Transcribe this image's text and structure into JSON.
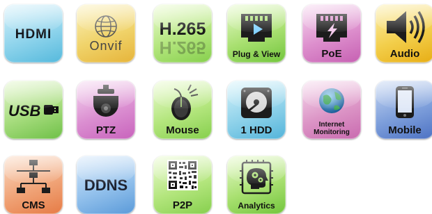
{
  "tiles": {
    "hdmi": {
      "text": "HDMI",
      "icon": "hdmi-logo-icon"
    },
    "onvif": {
      "text": "Onvif",
      "icon": "globe-icon"
    },
    "h265": {
      "text": "H.265",
      "reflection": "H.265",
      "icon": "h265-logo-icon"
    },
    "plug": {
      "label": "Plug & View",
      "icon": "ethernet-play-icon"
    },
    "poe": {
      "label": "PoE",
      "icon": "ethernet-power-icon"
    },
    "audio": {
      "label": "Audio",
      "icon": "speaker-icon"
    },
    "usb": {
      "text": "USB",
      "icon": "usb-icon"
    },
    "ptz": {
      "label": "PTZ",
      "icon": "dome-camera-icon"
    },
    "mouse": {
      "label": "Mouse",
      "icon": "mouse-icon"
    },
    "hdd": {
      "label": "1 HDD",
      "icon": "hard-drive-icon"
    },
    "inet": {
      "label_line1": "Internet",
      "label_line2": "Monitoring",
      "icon": "globe-icon"
    },
    "mobile": {
      "label": "Mobile",
      "icon": "smartphone-icon"
    },
    "cms": {
      "label": "CMS",
      "icon": "network-tree-icon"
    },
    "ddns": {
      "text": "DDNS",
      "icon": "ddns-text-icon"
    },
    "p2p": {
      "label": "P2P",
      "icon": "qr-code-icon"
    },
    "analy": {
      "label": "Analytics",
      "icon": "brain-gears-icon"
    }
  }
}
